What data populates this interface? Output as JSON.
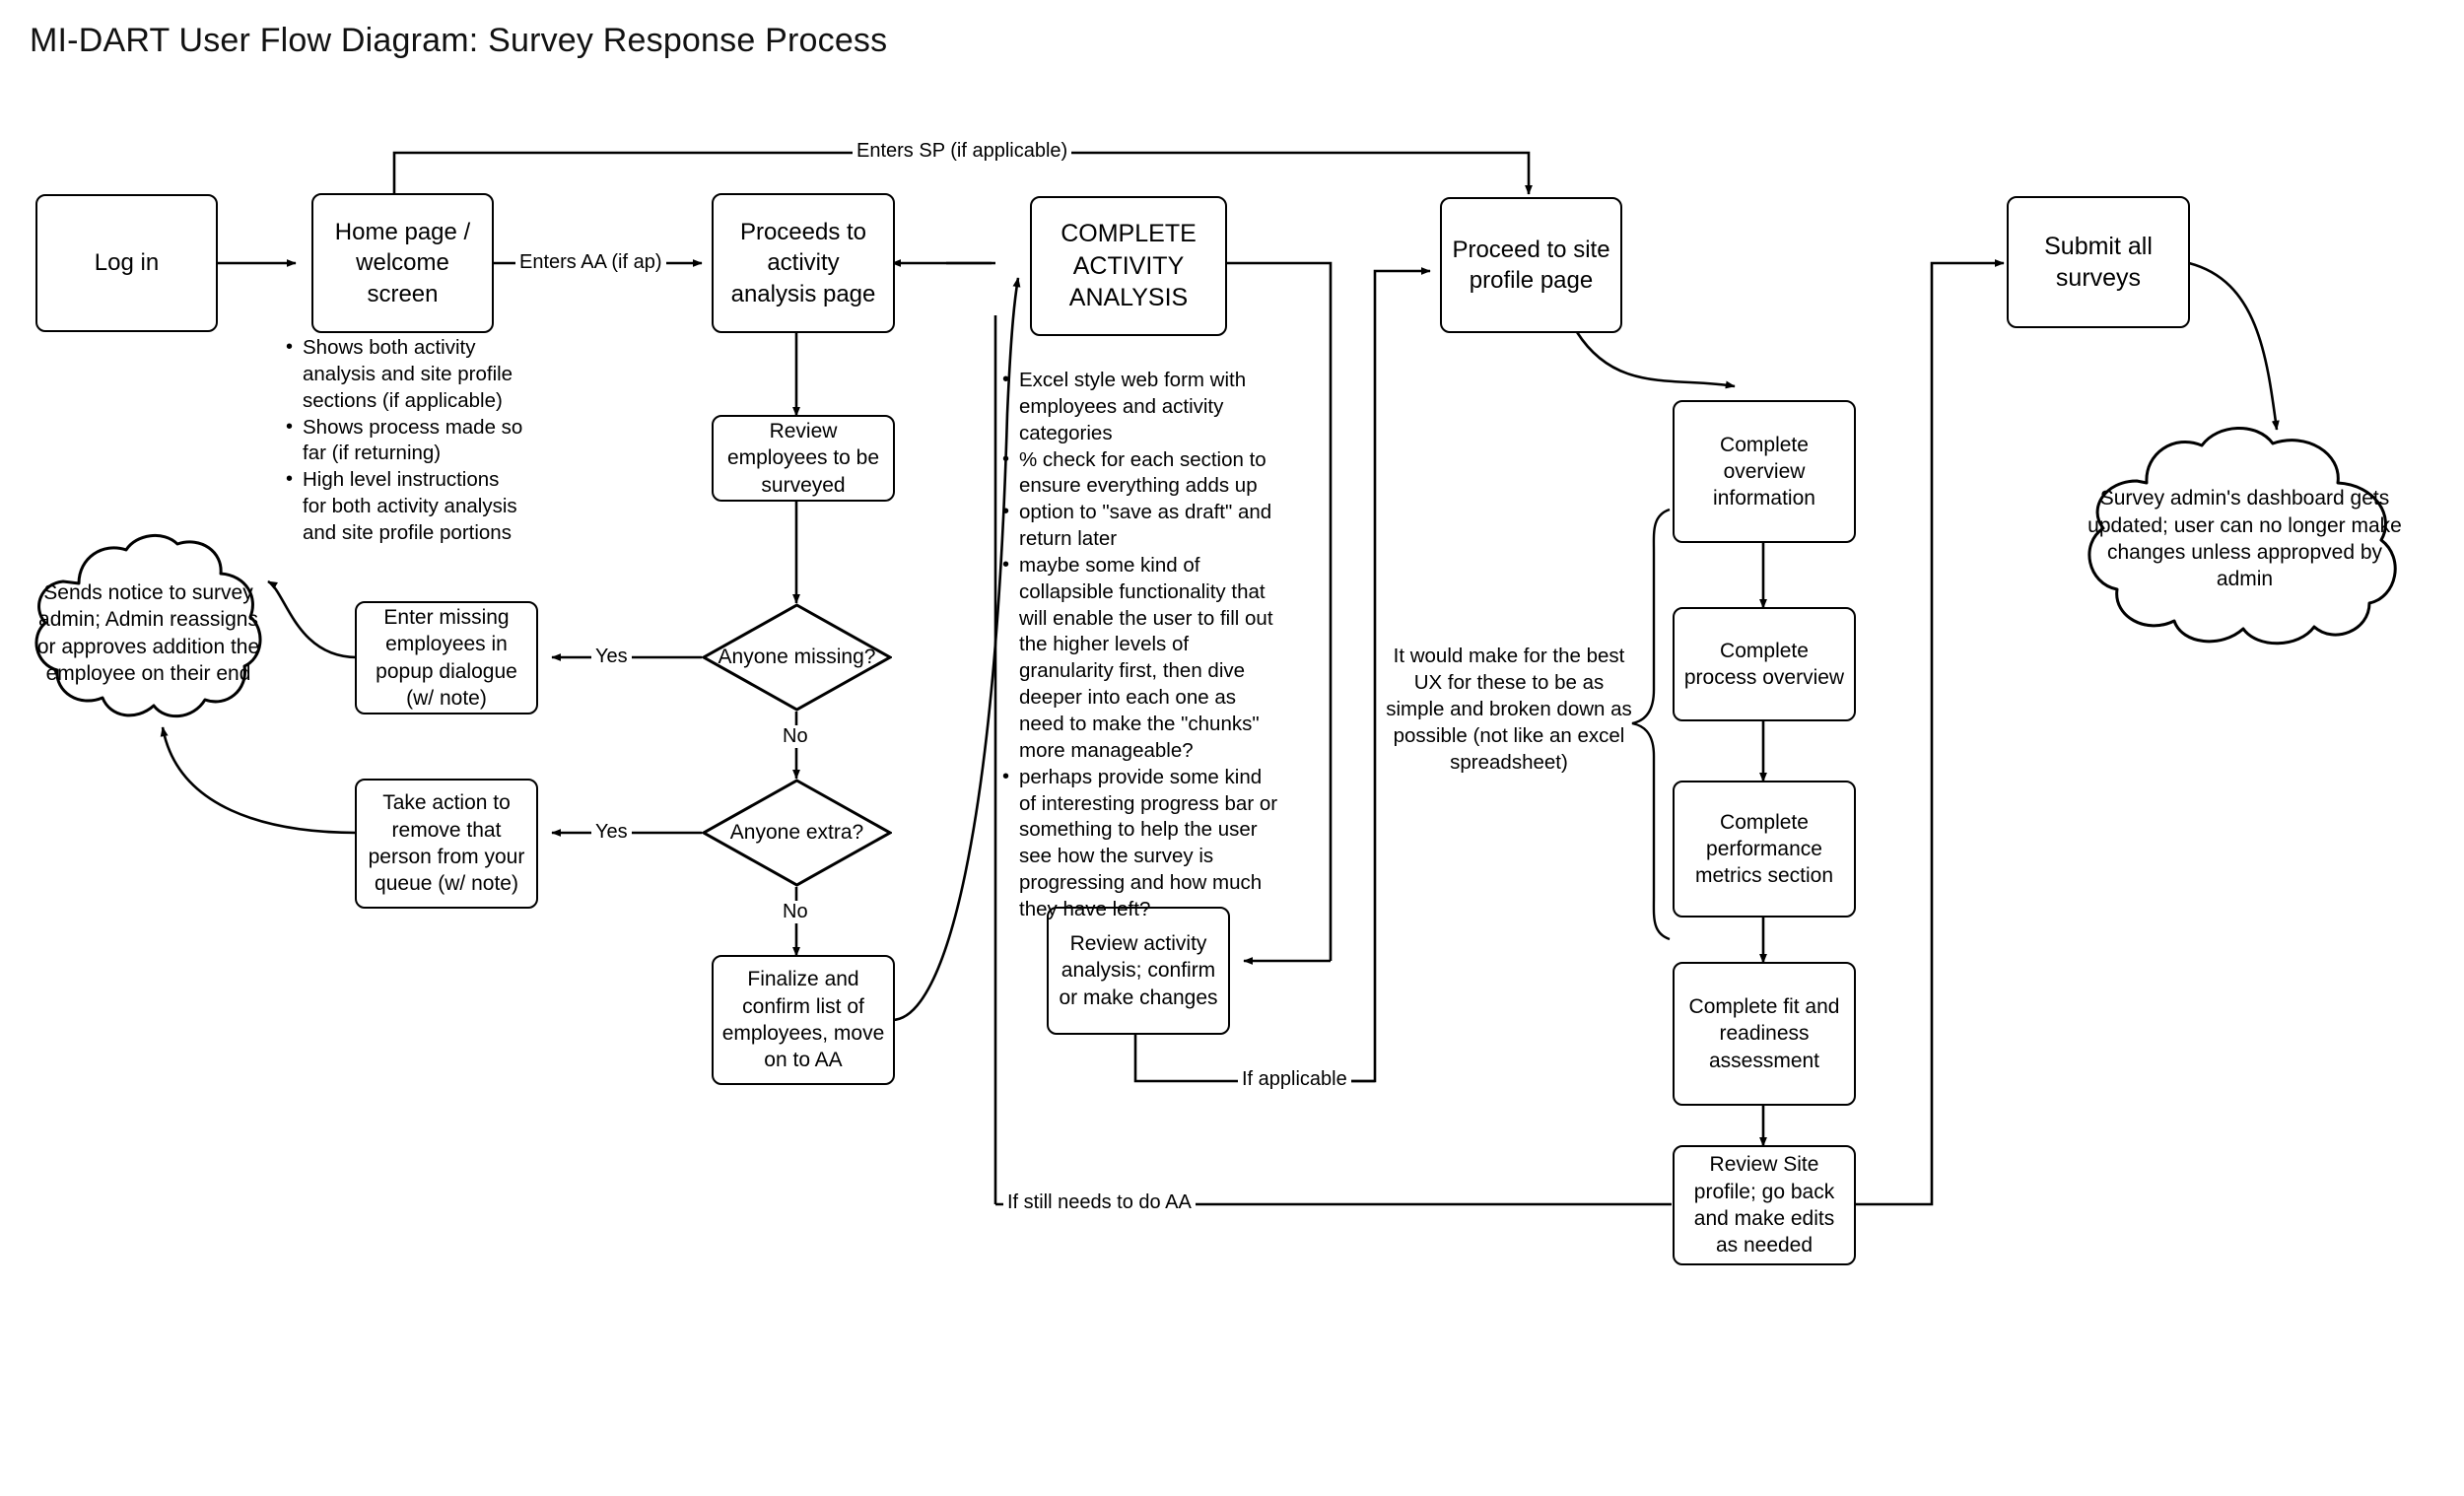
{
  "title": "MI-DART User Flow Diagram: Survey Response Process",
  "colors": {
    "stroke": "#000000",
    "background": "#ffffff",
    "text": "#000000"
  },
  "nodes": {
    "login": "Log in",
    "home": "Home page / welcome screen",
    "proceeds_aa": "Proceeds to activity analysis page",
    "complete_aa": "COMPLETE ACTIVITY ANALYSIS",
    "proceed_sp": "Proceed to site profile page",
    "submit_all": "Submit all surveys",
    "review_employees": "Review employees to be surveyed",
    "enter_missing": "Enter missing employees in popup dialogue (w/ note)",
    "take_action": "Take action to remove that person from your queue (w/ note)",
    "finalize": "Finalize and confirm list of employees, move on to AA",
    "review_aa": "Review activity analysis; confirm or make changes",
    "complete_overview": "Complete overview information",
    "complete_process": "Complete process overview",
    "complete_metrics": "Complete performance metrics section",
    "complete_fit": "Complete fit and readiness assessment",
    "review_sp": "Review Site profile; go back and make edits as needed"
  },
  "decisions": {
    "anyone_missing": "Anyone missing?",
    "anyone_extra": "Anyone extra?"
  },
  "clouds": {
    "admin_notice": "Sends notice to survey admin; Admin reassigns or approves addition the employee on their end",
    "admin_dashboard": "Survey admin's dashboard gets updated; user can no longer make changes unless appropved by admin"
  },
  "edge_labels": {
    "enters_sp": "Enters SP (if applicable)",
    "enters_aa": "Enters AA (if ap)",
    "yes_missing": "Yes",
    "no_missing": "No",
    "yes_extra": "Yes",
    "no_extra": "No",
    "if_applicable": "If applicable",
    "if_still_aa": "If still needs to do AA"
  },
  "notes": {
    "home_bullets": [
      "Shows both activity analysis and site profile sections (if applicable)",
      "Shows process made so far (if returning)",
      "High level instructions for both activity analysis and site profile portions"
    ],
    "aa_bullets": [
      "Excel style web form with employees and activity categories",
      "% check for each section to ensure everything adds up",
      "option to \"save as draft\" and return later",
      "maybe some kind of collapsible functionality that will enable the user to fill out the higher levels of granularity first, then dive deeper into each one as need to make the \"chunks\" more manageable?",
      "perhaps provide some kind of interesting progress bar or something to help the user see how the survey is progressing and how much they have left?"
    ],
    "ux_annotation": "It would make for the best UX for these to be as simple and broken down as possible (not like an excel spreadsheet)"
  }
}
